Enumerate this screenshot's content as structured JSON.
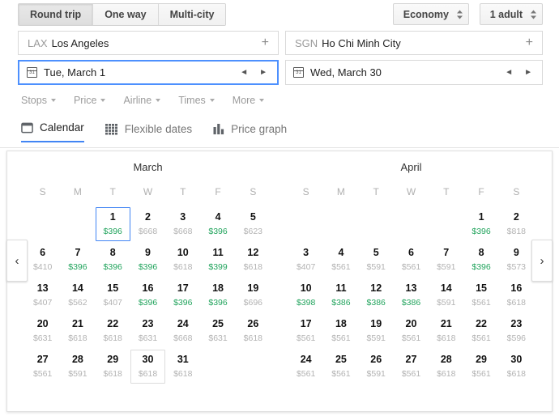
{
  "trip_tabs": [
    {
      "label": "Round trip",
      "active": true
    },
    {
      "label": "One way",
      "active": false
    },
    {
      "label": "Multi-city",
      "active": false
    }
  ],
  "cabin": {
    "value": "Economy"
  },
  "passengers": {
    "value": "1 adult"
  },
  "origin": {
    "code": "LAX",
    "city": "Los Angeles",
    "add": "+"
  },
  "destination": {
    "code": "SGN",
    "city": "Ho Chi Minh City",
    "add": "+"
  },
  "depart": {
    "value": "Tue, March 1",
    "prev": "◄",
    "next": "►"
  },
  "return": {
    "value": "Wed, March 30",
    "prev": "◄",
    "next": "►"
  },
  "filters": [
    {
      "label": "Stops"
    },
    {
      "label": "Price"
    },
    {
      "label": "Airline"
    },
    {
      "label": "Times"
    },
    {
      "label": "More"
    }
  ],
  "view_tabs": [
    {
      "label": "Calendar",
      "icon": "calendar-icon",
      "active": true
    },
    {
      "label": "Flexible dates",
      "icon": "grid-icon",
      "active": false
    },
    {
      "label": "Price graph",
      "icon": "bar-chart-icon",
      "active": false
    }
  ],
  "nav": {
    "prev": "‹",
    "next": "›"
  },
  "colors": {
    "accent": "#4285f4",
    "low_price": "#22a45d",
    "normal_price": "#b3b3b3"
  },
  "calendar": {
    "dow": [
      "S",
      "M",
      "T",
      "W",
      "T",
      "F",
      "S"
    ],
    "months": [
      {
        "title": "March",
        "weeks": [
          [
            null,
            null,
            {
              "day": "1",
              "price": "$396",
              "low": true,
              "selected": true
            },
            {
              "day": "2",
              "price": "$668",
              "low": false
            },
            {
              "day": "3",
              "price": "$668",
              "low": false
            },
            {
              "day": "4",
              "price": "$396",
              "low": true
            },
            {
              "day": "5",
              "price": "$623",
              "low": false
            }
          ],
          [
            {
              "day": "6",
              "price": "$410",
              "low": false
            },
            {
              "day": "7",
              "price": "$396",
              "low": true
            },
            {
              "day": "8",
              "price": "$396",
              "low": true
            },
            {
              "day": "9",
              "price": "$396",
              "low": true
            },
            {
              "day": "10",
              "price": "$618",
              "low": false
            },
            {
              "day": "11",
              "price": "$399",
              "low": true
            },
            {
              "day": "12",
              "price": "$618",
              "low": false
            }
          ],
          [
            {
              "day": "13",
              "price": "$407",
              "low": false
            },
            {
              "day": "14",
              "price": "$562",
              "low": false
            },
            {
              "day": "15",
              "price": "$407",
              "low": false
            },
            {
              "day": "16",
              "price": "$396",
              "low": true
            },
            {
              "day": "17",
              "price": "$396",
              "low": true
            },
            {
              "day": "18",
              "price": "$396",
              "low": true
            },
            {
              "day": "19",
              "price": "$696",
              "low": false
            }
          ],
          [
            {
              "day": "20",
              "price": "$631",
              "low": false
            },
            {
              "day": "21",
              "price": "$618",
              "low": false
            },
            {
              "day": "22",
              "price": "$618",
              "low": false
            },
            {
              "day": "23",
              "price": "$631",
              "low": false
            },
            {
              "day": "24",
              "price": "$668",
              "low": false
            },
            {
              "day": "25",
              "price": "$631",
              "low": false
            },
            {
              "day": "26",
              "price": "$618",
              "low": false
            }
          ],
          [
            {
              "day": "27",
              "price": "$561",
              "low": false
            },
            {
              "day": "28",
              "price": "$591",
              "low": false
            },
            {
              "day": "29",
              "price": "$618",
              "low": false
            },
            {
              "day": "30",
              "price": "$618",
              "low": false,
              "outline": true
            },
            {
              "day": "31",
              "price": "$618",
              "low": false
            },
            null,
            null
          ]
        ]
      },
      {
        "title": "April",
        "weeks": [
          [
            null,
            null,
            null,
            null,
            null,
            {
              "day": "1",
              "price": "$396",
              "low": true
            },
            {
              "day": "2",
              "price": "$818",
              "low": false
            }
          ],
          [
            {
              "day": "3",
              "price": "$407",
              "low": false
            },
            {
              "day": "4",
              "price": "$561",
              "low": false
            },
            {
              "day": "5",
              "price": "$591",
              "low": false
            },
            {
              "day": "6",
              "price": "$561",
              "low": false
            },
            {
              "day": "7",
              "price": "$591",
              "low": false
            },
            {
              "day": "8",
              "price": "$396",
              "low": true
            },
            {
              "day": "9",
              "price": "$573",
              "low": false
            }
          ],
          [
            {
              "day": "10",
              "price": "$398",
              "low": true
            },
            {
              "day": "11",
              "price": "$386",
              "low": true
            },
            {
              "day": "12",
              "price": "$386",
              "low": true
            },
            {
              "day": "13",
              "price": "$386",
              "low": true
            },
            {
              "day": "14",
              "price": "$591",
              "low": false
            },
            {
              "day": "15",
              "price": "$561",
              "low": false
            },
            {
              "day": "16",
              "price": "$618",
              "low": false
            }
          ],
          [
            {
              "day": "17",
              "price": "$561",
              "low": false
            },
            {
              "day": "18",
              "price": "$561",
              "low": false
            },
            {
              "day": "19",
              "price": "$591",
              "low": false
            },
            {
              "day": "20",
              "price": "$561",
              "low": false
            },
            {
              "day": "21",
              "price": "$618",
              "low": false
            },
            {
              "day": "22",
              "price": "$561",
              "low": false
            },
            {
              "day": "23",
              "price": "$596",
              "low": false
            }
          ],
          [
            {
              "day": "24",
              "price": "$561",
              "low": false
            },
            {
              "day": "25",
              "price": "$561",
              "low": false
            },
            {
              "day": "26",
              "price": "$591",
              "low": false
            },
            {
              "day": "27",
              "price": "$561",
              "low": false
            },
            {
              "day": "28",
              "price": "$618",
              "low": false
            },
            {
              "day": "29",
              "price": "$561",
              "low": false
            },
            {
              "day": "30",
              "price": "$618",
              "low": false
            }
          ],
          [
            null,
            null,
            null,
            null,
            null,
            null,
            null
          ]
        ]
      }
    ]
  }
}
